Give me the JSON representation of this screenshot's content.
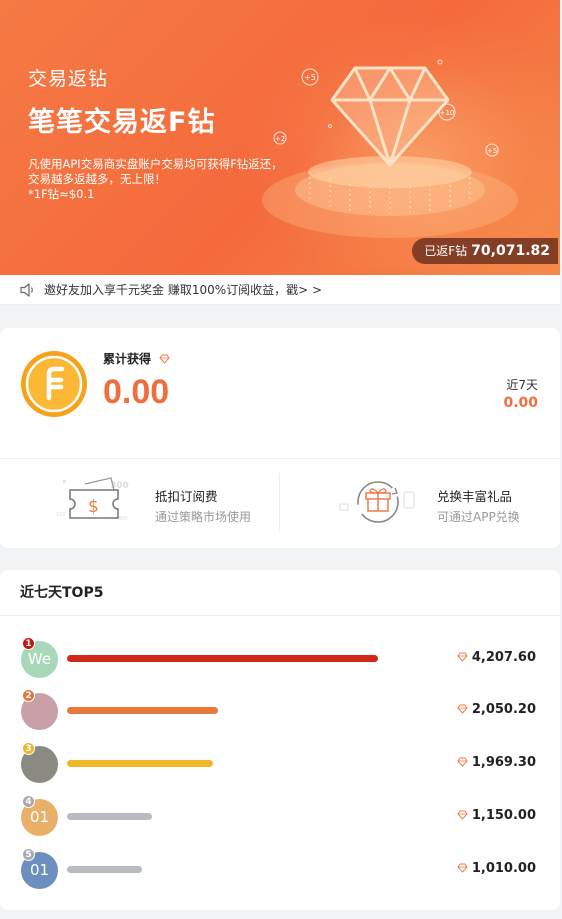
{
  "banner": {
    "subtitle": "交易返钻",
    "title": "笔笔交易返F钻",
    "desc": [
      "凡使用API交易商实盘账户交易均可获得F钻返还，",
      "交易越多返越多，无上限！",
      "*1F钻≈$0.1"
    ],
    "total_label": "已返F钻",
    "total_value": "70,071.82",
    "floating_labels": [
      "+5",
      "+10",
      "+2",
      "+5"
    ]
  },
  "notice": {
    "text": "邀好友加入享千元奖金 赚取100%订阅收益，戳> >"
  },
  "earnings": {
    "label": "累计获得",
    "value": "0.00",
    "recent_label": "近7天",
    "recent_value": "0.00"
  },
  "features": [
    {
      "title": "抵扣订阅费",
      "subtitle": "通过策略市场使用",
      "icon": "voucher-dollar-icon"
    },
    {
      "title": "兑换丰富礼品",
      "subtitle": "可通过APP兑换",
      "icon": "gift-exchange-icon"
    }
  ],
  "ranking": {
    "title": "近七天TOP5",
    "rows": [
      {
        "rank": "1",
        "avatar_text": "We",
        "avatar_color": "#a8d8b9",
        "rank_color": "#c8170e",
        "bar_color": "#d2281a",
        "fraction": 1.0,
        "amount": "4,207.60"
      },
      {
        "rank": "2",
        "avatar_text": "",
        "avatar_color": "#c9a0a8",
        "rank_color": "#e0783a",
        "bar_color": "#e77a39",
        "fraction": 0.487,
        "amount": "2,050.20"
      },
      {
        "rank": "3",
        "avatar_text": "",
        "avatar_color": "#8a8a82",
        "rank_color": "#f0b62a",
        "bar_color": "#f0b62a",
        "fraction": 0.468,
        "amount": "1,969.30"
      },
      {
        "rank": "4",
        "avatar_text": "01",
        "avatar_color": "#e9b06a",
        "rank_color": "#a9a9a9",
        "bar_color": "#b8bcc2",
        "fraction": 0.273,
        "amount": "1,150.00"
      },
      {
        "rank": "5",
        "avatar_text": "01",
        "avatar_color": "#6b8fbf",
        "rank_color": "#a9a9a9",
        "bar_color": "#b8bcc2",
        "fraction": 0.24,
        "amount": "1,010.00"
      }
    ]
  },
  "colors": {
    "accent": "#f26d3d",
    "banner": "#f46a3c"
  }
}
